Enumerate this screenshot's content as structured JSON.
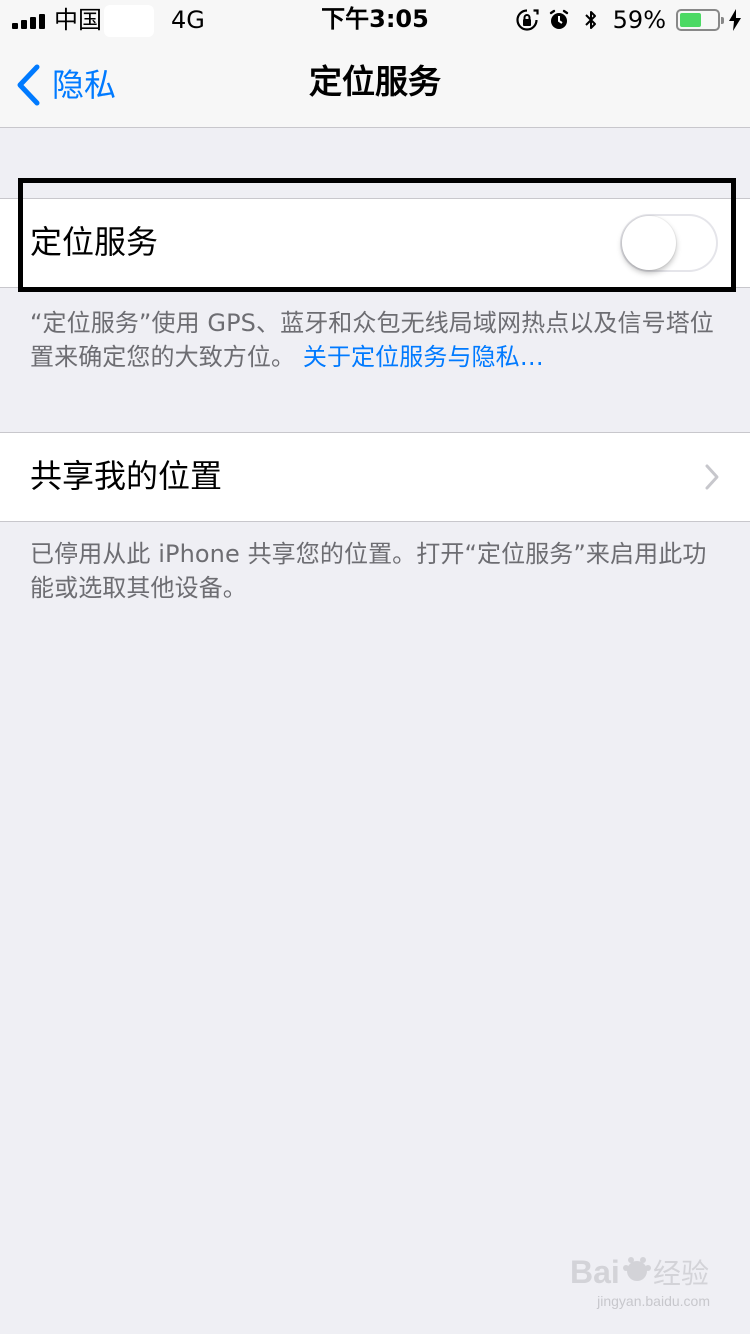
{
  "status_bar": {
    "carrier": "中国",
    "network": "4G",
    "time": "下午3:05",
    "battery_percent": "59%",
    "battery_level": 0.59,
    "icons": [
      "signal-icon",
      "rotation-lock-icon",
      "alarm-icon",
      "bluetooth-icon",
      "battery-icon",
      "charging-icon"
    ]
  },
  "nav": {
    "back_label": "隐私",
    "title": "定位服务"
  },
  "location_services": {
    "label": "定位服务",
    "toggle_state": "off",
    "footnote_text": "“定位服务”使用 GPS、蓝牙和众包无线局域网热点以及信号塔位置来确定您的大致方位。",
    "footnote_link": "关于定位服务与隐私…"
  },
  "share_location": {
    "label": "共享我的位置",
    "footnote_text": "已停用从此 iPhone 共享您的位置。打开“定位服务”来启用此功能或选取其他设备。"
  },
  "watermark": {
    "subtext": "jingyan.baidu.com"
  },
  "colors": {
    "accent": "#007aff",
    "background": "#efeff4",
    "battery": "#4cd964",
    "secondary_text": "#6d6d72"
  }
}
